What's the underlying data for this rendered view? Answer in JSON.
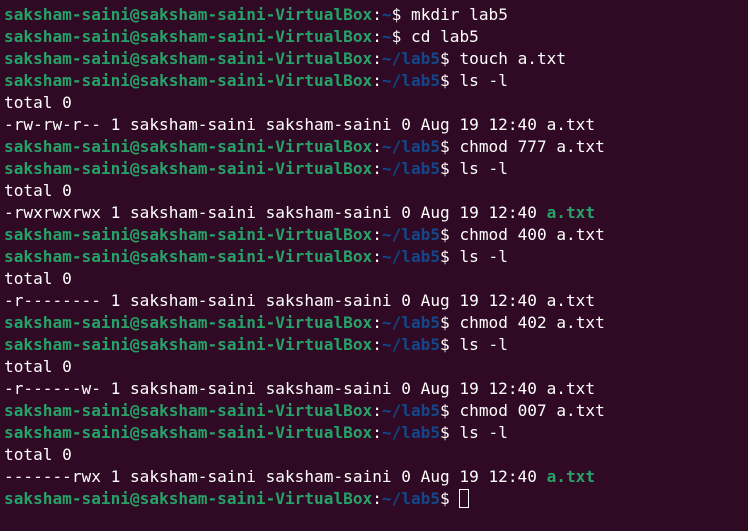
{
  "terminal": {
    "user_host": "saksham-saini@saksham-saini-VirtualBox",
    "colors": {
      "background": "#300a24",
      "user_host": "#26a269",
      "path": "#12488b",
      "text": "#ffffff",
      "executable": "#26a269"
    },
    "lines": [
      {
        "type": "prompt",
        "path": "~",
        "command": "mkdir lab5"
      },
      {
        "type": "prompt",
        "path": "~",
        "command": "cd lab5"
      },
      {
        "type": "prompt",
        "path": "~/lab5",
        "command": "touch a.txt"
      },
      {
        "type": "prompt",
        "path": "~/lab5",
        "command": "ls -l"
      },
      {
        "type": "output",
        "text": "total 0"
      },
      {
        "type": "listing",
        "meta": "-rw-rw-r-- 1 saksham-saini saksham-saini 0 Aug 19 12:40 ",
        "file": "a.txt",
        "executable": false
      },
      {
        "type": "prompt",
        "path": "~/lab5",
        "command": "chmod 777 a.txt"
      },
      {
        "type": "prompt",
        "path": "~/lab5",
        "command": "ls -l"
      },
      {
        "type": "output",
        "text": "total 0"
      },
      {
        "type": "listing",
        "meta": "-rwxrwxrwx 1 saksham-saini saksham-saini 0 Aug 19 12:40 ",
        "file": "a.txt",
        "executable": true
      },
      {
        "type": "prompt",
        "path": "~/lab5",
        "command": "chmod 400 a.txt"
      },
      {
        "type": "prompt",
        "path": "~/lab5",
        "command": "ls -l"
      },
      {
        "type": "output",
        "text": "total 0"
      },
      {
        "type": "listing",
        "meta": "-r-------- 1 saksham-saini saksham-saini 0 Aug 19 12:40 ",
        "file": "a.txt",
        "executable": false
      },
      {
        "type": "prompt",
        "path": "~/lab5",
        "command": "chmod 402 a.txt"
      },
      {
        "type": "prompt",
        "path": "~/lab5",
        "command": "ls -l"
      },
      {
        "type": "output",
        "text": "total 0"
      },
      {
        "type": "listing",
        "meta": "-r------w- 1 saksham-saini saksham-saini 0 Aug 19 12:40 ",
        "file": "a.txt",
        "executable": false
      },
      {
        "type": "prompt",
        "path": "~/lab5",
        "command": "chmod 007 a.txt"
      },
      {
        "type": "prompt",
        "path": "~/lab5",
        "command": "ls -l"
      },
      {
        "type": "output",
        "text": "total 0"
      },
      {
        "type": "listing",
        "meta": "-------rwx 1 saksham-saini saksham-saini 0 Aug 19 12:40 ",
        "file": "a.txt",
        "executable": true
      },
      {
        "type": "prompt",
        "path": "~/lab5",
        "command": "",
        "active": true
      }
    ]
  }
}
